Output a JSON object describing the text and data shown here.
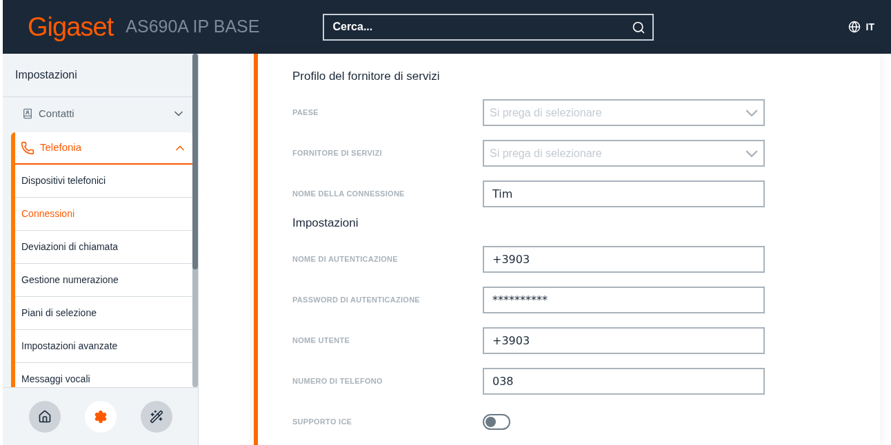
{
  "header": {
    "logo": "Gigaset",
    "product": "AS690A IP BASE",
    "search": {
      "placeholder": "Cerca..."
    },
    "language": "IT"
  },
  "sidebar": {
    "title": "Impostazioni",
    "sections": [
      {
        "label": "Contatti",
        "expanded": false
      },
      {
        "label": "Telefonia",
        "expanded": true,
        "items": [
          {
            "label": "Dispositivi telefonici",
            "selected": false
          },
          {
            "label": "Connessioni",
            "selected": true
          },
          {
            "label": "Deviazioni di chiamata",
            "selected": false
          },
          {
            "label": "Gestione numerazione",
            "selected": false
          },
          {
            "label": "Piani di selezione",
            "selected": false
          },
          {
            "label": "Impostazioni avanzate",
            "selected": false
          },
          {
            "label": "Messaggi vocali",
            "selected": false
          }
        ]
      }
    ],
    "bottom_buttons": [
      {
        "kind": "home",
        "selected": false
      },
      {
        "kind": "settings",
        "selected": true
      },
      {
        "kind": "wizard",
        "selected": false
      }
    ]
  },
  "form": {
    "sections": [
      {
        "title": "Profilo del fornitore di servizi",
        "fields": [
          {
            "kind": "select",
            "label": "PAESE",
            "placeholder": "Si prega di selezionare"
          },
          {
            "kind": "select",
            "label": "FORNITORE DI SERVIZI",
            "placeholder": "Si prega di selezionare"
          },
          {
            "kind": "text",
            "label": "NOME DELLA CONNESSIONE",
            "value": "Tim"
          }
        ]
      },
      {
        "title": "Impostazioni",
        "fields": [
          {
            "kind": "text",
            "label": "NOME DI AUTENTICAZIONE",
            "value": "+3903"
          },
          {
            "kind": "text",
            "label": "PASSWORD DI AUTENTICAZIONE",
            "value": "**********"
          },
          {
            "kind": "text",
            "label": "NOME UTENTE",
            "value": "+3903"
          },
          {
            "kind": "text",
            "label": "NUMERO DI TELEFONO",
            "value": "038"
          },
          {
            "kind": "toggle",
            "label": "SUPPORTO ICE",
            "on": false
          }
        ]
      }
    ]
  }
}
